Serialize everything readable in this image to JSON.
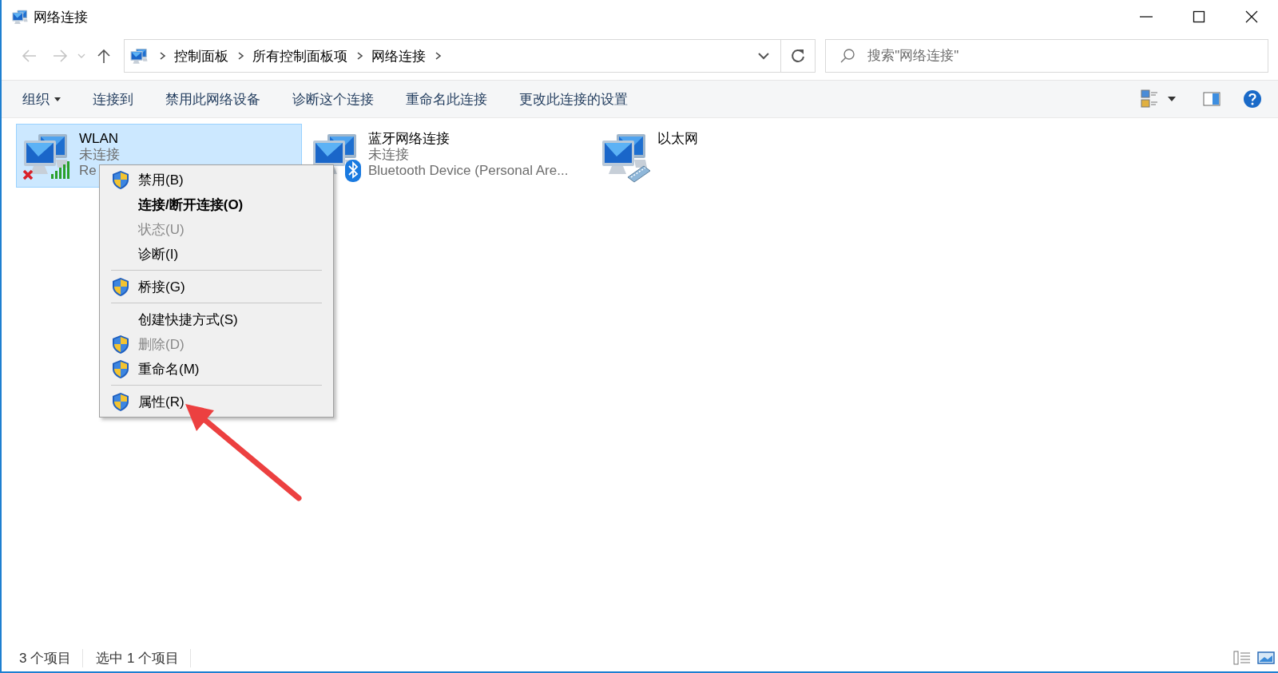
{
  "window": {
    "title": "网络连接"
  },
  "address_bar": {
    "breadcrumbs": [
      "控制面板",
      "所有控制面板项",
      "网络连接"
    ],
    "search": {
      "placeholder": "搜索\"网络连接\""
    }
  },
  "toolbar": {
    "commands": [
      {
        "label": "组织",
        "dropdown": true
      },
      {
        "label": "连接到",
        "dropdown": false
      },
      {
        "label": "禁用此网络设备",
        "dropdown": false
      },
      {
        "label": "诊断这个连接",
        "dropdown": false
      },
      {
        "label": "重命名此连接",
        "dropdown": false
      },
      {
        "label": "更改此连接的设置",
        "dropdown": false
      }
    ]
  },
  "connections": [
    {
      "kind": "wifi",
      "name": "WLAN",
      "status": "未连接",
      "device": "Re",
      "selected": true
    },
    {
      "kind": "bluetooth",
      "name": "蓝牙网络连接",
      "status": "未连接",
      "device": "Bluetooth Device (Personal Are...",
      "selected": false
    },
    {
      "kind": "ethernet",
      "name": "以太网",
      "selected": false
    }
  ],
  "context_menu": {
    "items": [
      {
        "kind": "item",
        "label": "禁用(B)",
        "shield": true,
        "disabled": false,
        "default": false
      },
      {
        "kind": "item",
        "label": "连接/断开连接(O)",
        "shield": false,
        "disabled": false,
        "default": true
      },
      {
        "kind": "item",
        "label": "状态(U)",
        "shield": false,
        "disabled": true,
        "default": false
      },
      {
        "kind": "item",
        "label": "诊断(I)",
        "shield": false,
        "disabled": false,
        "default": false
      },
      {
        "kind": "separator"
      },
      {
        "kind": "item",
        "label": "桥接(G)",
        "shield": true,
        "disabled": false,
        "default": false
      },
      {
        "kind": "separator"
      },
      {
        "kind": "item",
        "label": "创建快捷方式(S)",
        "shield": false,
        "disabled": false,
        "default": false
      },
      {
        "kind": "item",
        "label": "删除(D)",
        "shield": true,
        "disabled": true,
        "default": false
      },
      {
        "kind": "item",
        "label": "重命名(M)",
        "shield": true,
        "disabled": false,
        "default": false
      },
      {
        "kind": "separator"
      },
      {
        "kind": "item",
        "label": "属性(R)",
        "shield": true,
        "disabled": false,
        "default": false
      }
    ]
  },
  "status_bar": {
    "item_count": "3 个项目",
    "selection": "选中 1 个项目"
  }
}
